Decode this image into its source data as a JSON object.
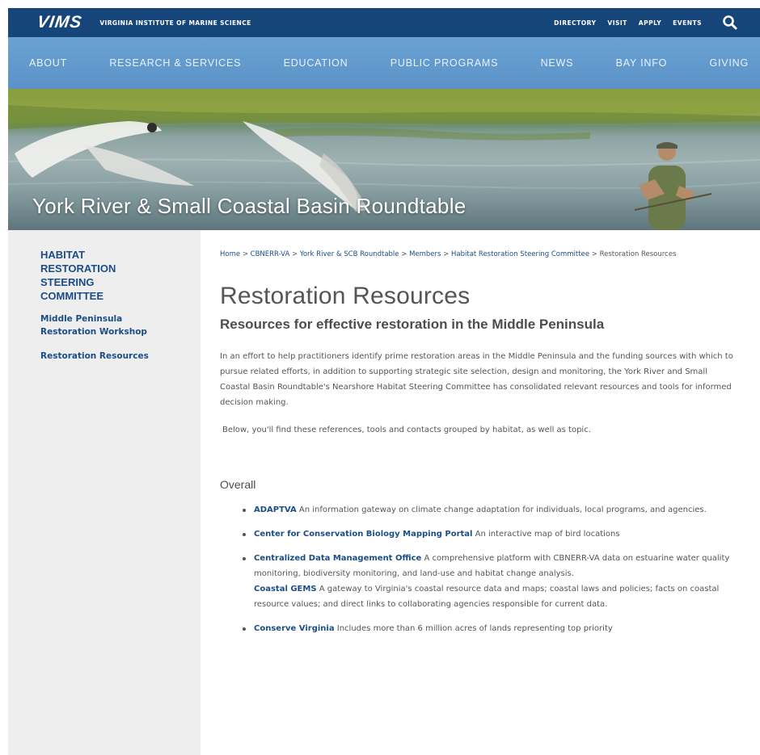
{
  "header": {
    "logo": "VIMS",
    "institution": "VIRGINIA INSTITUTE OF MARINE SCIENCE",
    "utility_links": [
      "DIRECTORY",
      "VISIT",
      "APPLY",
      "EVENTS"
    ]
  },
  "nav": {
    "items": [
      "ABOUT",
      "RESEARCH & SERVICES",
      "EDUCATION",
      "PUBLIC PROGRAMS",
      "NEWS",
      "BAY INFO",
      "GIVING"
    ]
  },
  "hero": {
    "title": "York River & Small Coastal Basin Roundtable"
  },
  "sidebar": {
    "heading": "HABITAT RESTORATION STEERING COMMITTEE",
    "links": [
      "Middle Peninsula Restoration Workshop",
      "Restoration Resources"
    ]
  },
  "breadcrumb": {
    "items": [
      "Home",
      "CBNERR-VA",
      "York River & SCB Roundtable",
      "Members",
      "Habitat Restoration Steering Committee"
    ],
    "current": "Restoration Resources",
    "separator": ">"
  },
  "main": {
    "title": "Restoration Resources",
    "subtitle": "Resources for effective restoration in the Middle Peninsula",
    "intro": "In an effort to help practitioners identify prime restoration areas in the Middle Peninsula and the funding sources with which to pursue related efforts, in addition to supporting strategic site selection, design and monitoring, the York River and Small Coastal Basin Roundtable's Nearshore Habitat Steering Committee has consolidated relevant resources and tools for informed decision making.",
    "intro2": "Below, you'll find these references, tools and contacts grouped by habitat, as well as topic.",
    "section_heading": "Overall",
    "resources": [
      {
        "name": "ADAPTVA",
        "desc": " An information gateway on climate change adaptation for individuals, local programs, and agencies."
      },
      {
        "name": "Center for Conservation Biology Mapping Portal",
        "desc": " An interactive map of bird locations"
      },
      {
        "name": "Centralized Data Management Office",
        "desc": " A comprehensive platform with CBNERR-VA data on estuarine water quality monitoring, biodiversity monitoring, and land-use and habitat change analysis.",
        "sub_name": "Coastal GEMS",
        "sub_desc": " A gateway to Virginia's coastal resource data and maps; coastal laws and policies; facts on coastal resource values; and direct links to collaborating agencies responsible for current data."
      },
      {
        "name": "Conserve Virginia",
        "desc": " Includes more than 6 million acres of lands representing top priority"
      }
    ]
  },
  "colors": {
    "topbar": "#16457a",
    "nav": "#5b93c7",
    "link": "#1c4d86",
    "sidebar_bg": "#eeeeee"
  }
}
